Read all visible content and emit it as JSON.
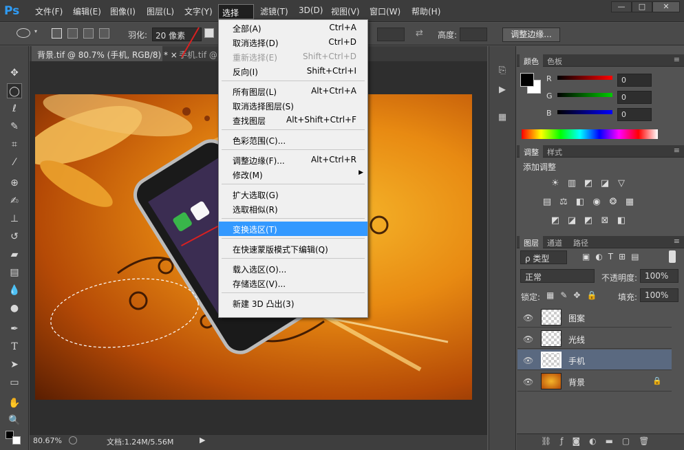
{
  "app": {
    "logo": "Ps"
  },
  "menubar": {
    "items": [
      "文件(F)",
      "编辑(E)",
      "图像(I)",
      "图层(L)",
      "文字(Y)",
      "选择(S)",
      "滤镜(T)",
      "3D(D)",
      "视图(V)",
      "窗口(W)",
      "帮助(H)"
    ],
    "window_buttons": [
      "—",
      "□",
      "✕"
    ]
  },
  "options": {
    "feather_label": "羽化:",
    "feather_value": "20 像素",
    "height_label": "高度:",
    "refine_button": "调整边缘..."
  },
  "tabs": [
    {
      "label": "背景.tif @ 80.7% (手机, RGB/8) *  ×",
      "active": true
    },
    {
      "label": "手机.tif @",
      "active": false
    }
  ],
  "status": {
    "zoom": "80.67%",
    "doc": "文档:1.24M/5.56M"
  },
  "select_menu": [
    {
      "label": "全部(A)",
      "shortcut": "Ctrl+A"
    },
    {
      "label": "取消选择(D)",
      "shortcut": "Ctrl+D"
    },
    {
      "label": "重新选择(E)",
      "shortcut": "Shift+Ctrl+D",
      "disabled": true
    },
    {
      "label": "反向(I)",
      "shortcut": "Shift+Ctrl+I"
    },
    {
      "sep": true
    },
    {
      "label": "所有图层(L)",
      "shortcut": "Alt+Ctrl+A"
    },
    {
      "label": "取消选择图层(S)",
      "shortcut": ""
    },
    {
      "label": "查找图层",
      "shortcut": "Alt+Shift+Ctrl+F"
    },
    {
      "sep": true
    },
    {
      "label": "色彩范围(C)...",
      "shortcut": ""
    },
    {
      "sep": true
    },
    {
      "label": "调整边缘(F)...",
      "shortcut": "Alt+Ctrl+R"
    },
    {
      "label": "修改(M)",
      "shortcut": "",
      "submenu": true
    },
    {
      "sep": true
    },
    {
      "label": "扩大选取(G)",
      "shortcut": ""
    },
    {
      "label": "选取相似(R)",
      "shortcut": ""
    },
    {
      "sep": true
    },
    {
      "label": "变换选区(T)",
      "shortcut": "",
      "highlighted": true
    },
    {
      "sep": true
    },
    {
      "label": "在快速蒙版模式下编辑(Q)",
      "shortcut": ""
    },
    {
      "sep": true
    },
    {
      "label": "载入选区(O)...",
      "shortcut": ""
    },
    {
      "label": "存储选区(V)...",
      "shortcut": ""
    },
    {
      "sep": true
    },
    {
      "label": "新建 3D 凸出(3)",
      "shortcut": ""
    }
  ],
  "color_panel": {
    "tabs": [
      "颜色",
      "色板"
    ],
    "channels": [
      {
        "name": "R",
        "value": "0",
        "color": "#ff0000"
      },
      {
        "name": "G",
        "value": "0",
        "color": "#00cc00"
      },
      {
        "name": "B",
        "value": "0",
        "color": "#0000ff"
      }
    ]
  },
  "adjust_panel": {
    "tabs": [
      "调整",
      "样式"
    ],
    "title": "添加调整"
  },
  "layers_panel": {
    "tabs": [
      "图层",
      "通道",
      "路径"
    ],
    "filter": "ρ 类型",
    "blend": "正常",
    "opacity_label": "不透明度:",
    "opacity": "100%",
    "lock_label": "锁定:",
    "fill_label": "填充:",
    "fill": "100%",
    "layers": [
      {
        "name": "图案",
        "selected": false
      },
      {
        "name": "光线",
        "selected": false
      },
      {
        "name": "手机",
        "selected": true
      },
      {
        "name": "背景",
        "selected": false,
        "locked": true
      }
    ]
  }
}
